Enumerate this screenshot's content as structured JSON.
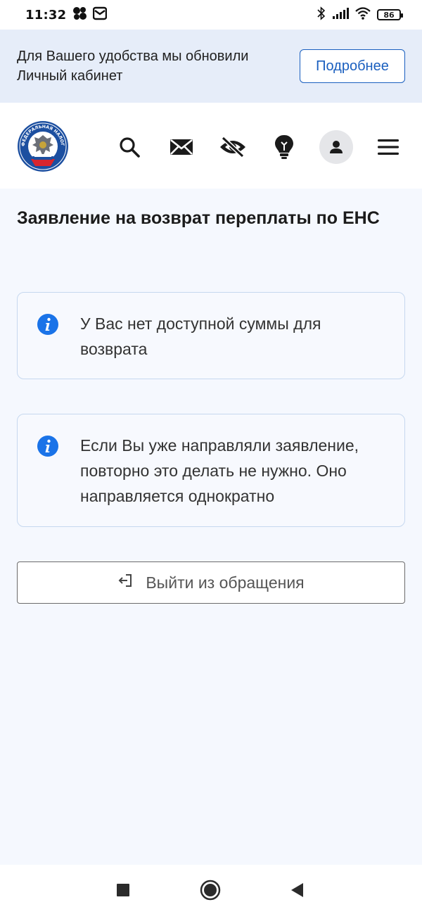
{
  "status_bar": {
    "time": "11:32",
    "battery": "86",
    "icons": [
      "app-notification-icon",
      "mail-icon",
      "bluetooth-icon",
      "signal-icon",
      "wifi-icon",
      "battery-icon"
    ]
  },
  "notice": {
    "text": "Для Вашего удобства мы обновили Личный кабинет",
    "button_label": "Подробнее"
  },
  "header": {
    "logo_text": "ФЕДЕРАЛЬНАЯ НАЛОГОВАЯ СЛУЖБА",
    "icons": [
      "search-icon",
      "mail-icon",
      "accessibility-eye-icon",
      "lightbulb-icon",
      "profile-icon",
      "menu-icon"
    ]
  },
  "page": {
    "title": "Заявление на возврат переплаты по ЕНС"
  },
  "cards": [
    {
      "text": "У Вас нет доступной суммы для возврата"
    },
    {
      "text": "Если Вы уже направляли заявление, повторно это делать не нужно. Оно направляется однократно"
    }
  ],
  "exit_button": {
    "label": "Выйти из обращения"
  },
  "colors": {
    "accent": "#1a5fbf",
    "info_icon": "#1a73e8",
    "notice_bg": "#e6edf9",
    "page_bg": "#f5f8fe",
    "card_border": "#c6d8ef"
  },
  "nav_bar": {
    "icons": [
      "recent-apps-icon",
      "home-icon",
      "back-icon"
    ]
  }
}
